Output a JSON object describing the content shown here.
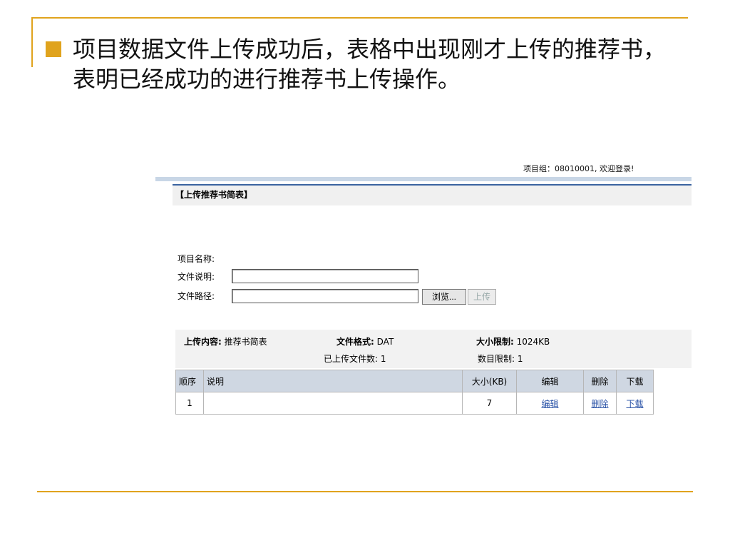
{
  "slide": {
    "bullet_text": "项目数据文件上传成功后，表格中出现刚才上传的推荐书，表明已经成功的进行推荐书上传操作。"
  },
  "screen": {
    "welcome": "项目组：08010001, 欢迎登录!",
    "section_title": "【上传推荐书简表】",
    "form": {
      "name_label": "项目名称:",
      "desc_label": "文件说明:",
      "desc_value": "",
      "path_label": "文件路径:",
      "path_value": "",
      "browse_label": "浏览...",
      "upload_label": "上传"
    },
    "info": {
      "content_label": "上传内容:",
      "content_value": "推荐书简表",
      "format_label": "文件格式:",
      "format_value": "DAT",
      "size_label": "大小限制:",
      "size_value": "1024KB",
      "uploaded_label": "已上传文件数:",
      "uploaded_value": "1",
      "count_label": "数目限制:",
      "count_value": "1"
    },
    "table": {
      "headers": [
        "顺序",
        "说明",
        "大小(KB)",
        "编辑",
        "删除",
        "下载"
      ],
      "rows": [
        {
          "order": "1",
          "desc": "",
          "size": "7",
          "edit": "编辑",
          "delete": "删除",
          "download": "下载"
        }
      ]
    }
  },
  "colors": {
    "accent": "#e0a31d",
    "header_border": "#3a63a0",
    "link": "#2d55a8"
  }
}
